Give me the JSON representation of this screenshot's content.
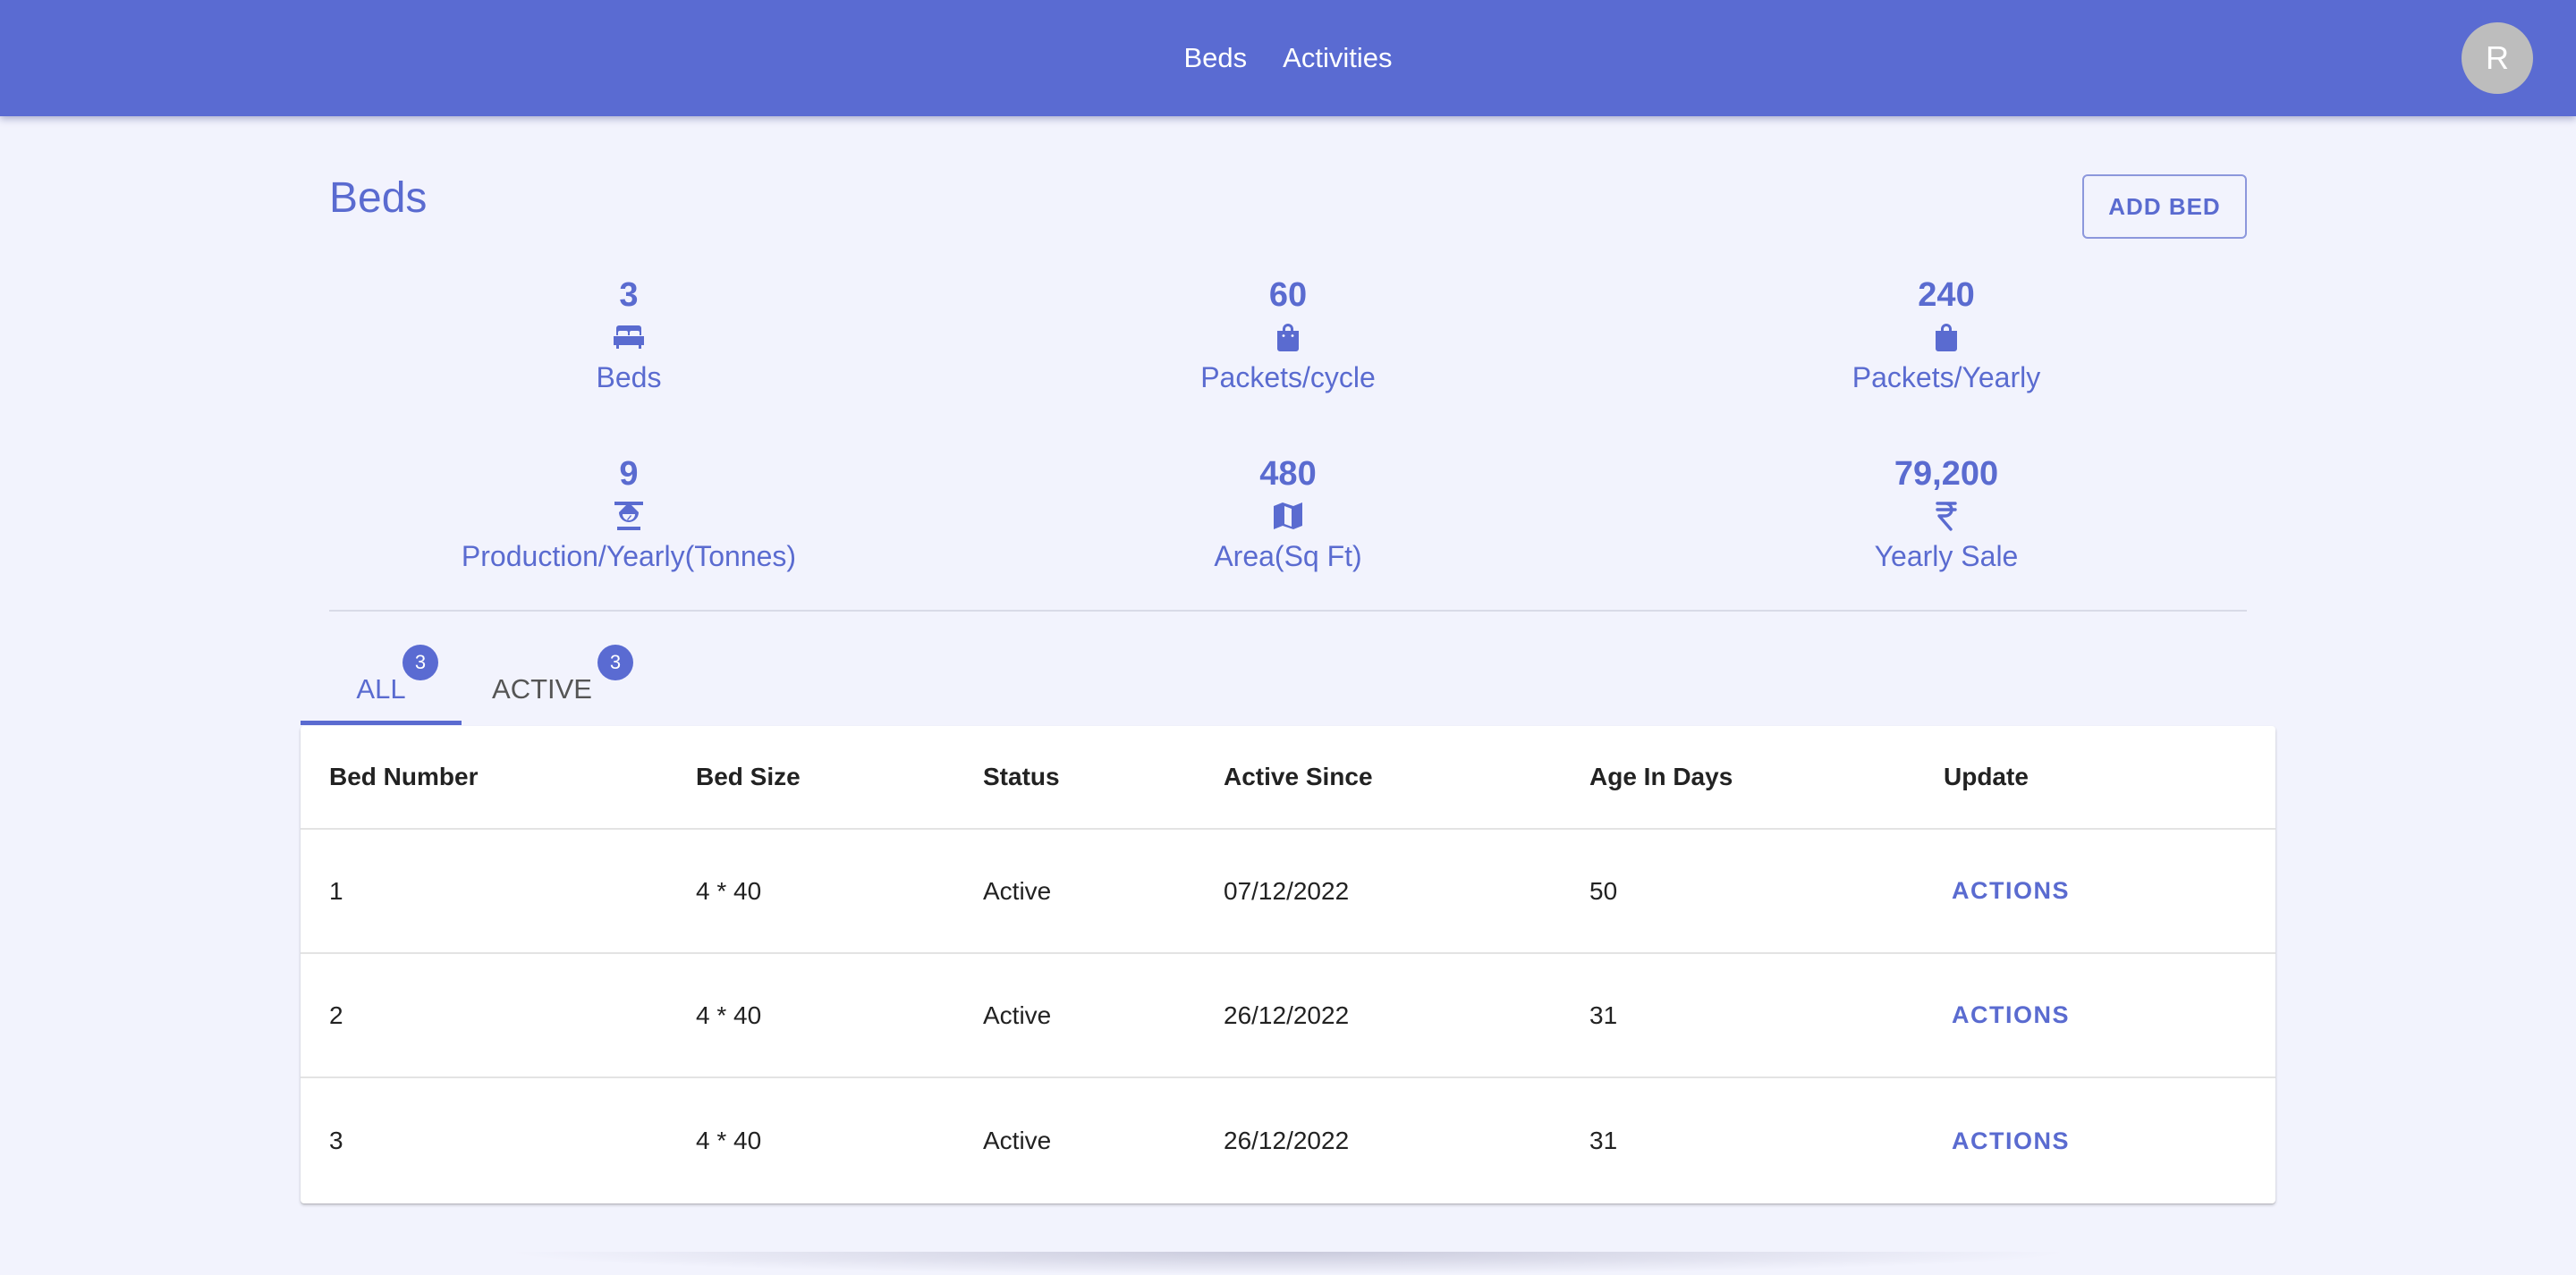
{
  "nav": {
    "links": [
      "Beds",
      "Activities"
    ],
    "avatar_initial": "R"
  },
  "page": {
    "title": "Beds",
    "add_button": "ADD BED"
  },
  "stats": [
    {
      "value": "3",
      "label": "Beds",
      "icon": "bed-icon"
    },
    {
      "value": "60",
      "label": "Packets/cycle",
      "icon": "bag-icon"
    },
    {
      "value": "240",
      "label": "Packets/Yearly",
      "icon": "bag-icon"
    },
    {
      "value": "9",
      "label": "Production/Yearly(Tonnes)",
      "icon": "scale-icon"
    },
    {
      "value": "480",
      "label": "Area(Sq Ft)",
      "icon": "map-icon"
    },
    {
      "value": "79,200",
      "label": "Yearly Sale",
      "icon": "rupee-icon"
    }
  ],
  "tabs": [
    {
      "label": "ALL",
      "count": "3",
      "selected": true
    },
    {
      "label": "ACTIVE",
      "count": "3",
      "selected": false
    }
  ],
  "table": {
    "headers": [
      "Bed Number",
      "Bed Size",
      "Status",
      "Active Since",
      "Age In Days",
      "Update"
    ],
    "rows": [
      {
        "bed_number": "1",
        "bed_size": "4 * 40",
        "status": "Active",
        "active_since": "07/12/2022",
        "age_in_days": "50",
        "action": "ACTIONS"
      },
      {
        "bed_number": "2",
        "bed_size": "4 * 40",
        "status": "Active",
        "active_since": "26/12/2022",
        "age_in_days": "31",
        "action": "ACTIONS"
      },
      {
        "bed_number": "3",
        "bed_size": "4 * 40",
        "status": "Active",
        "active_since": "26/12/2022",
        "age_in_days": "31",
        "action": "ACTIONS"
      }
    ]
  },
  "colors": {
    "primary": "#5a6bd2",
    "background": "#f2f3fd"
  }
}
